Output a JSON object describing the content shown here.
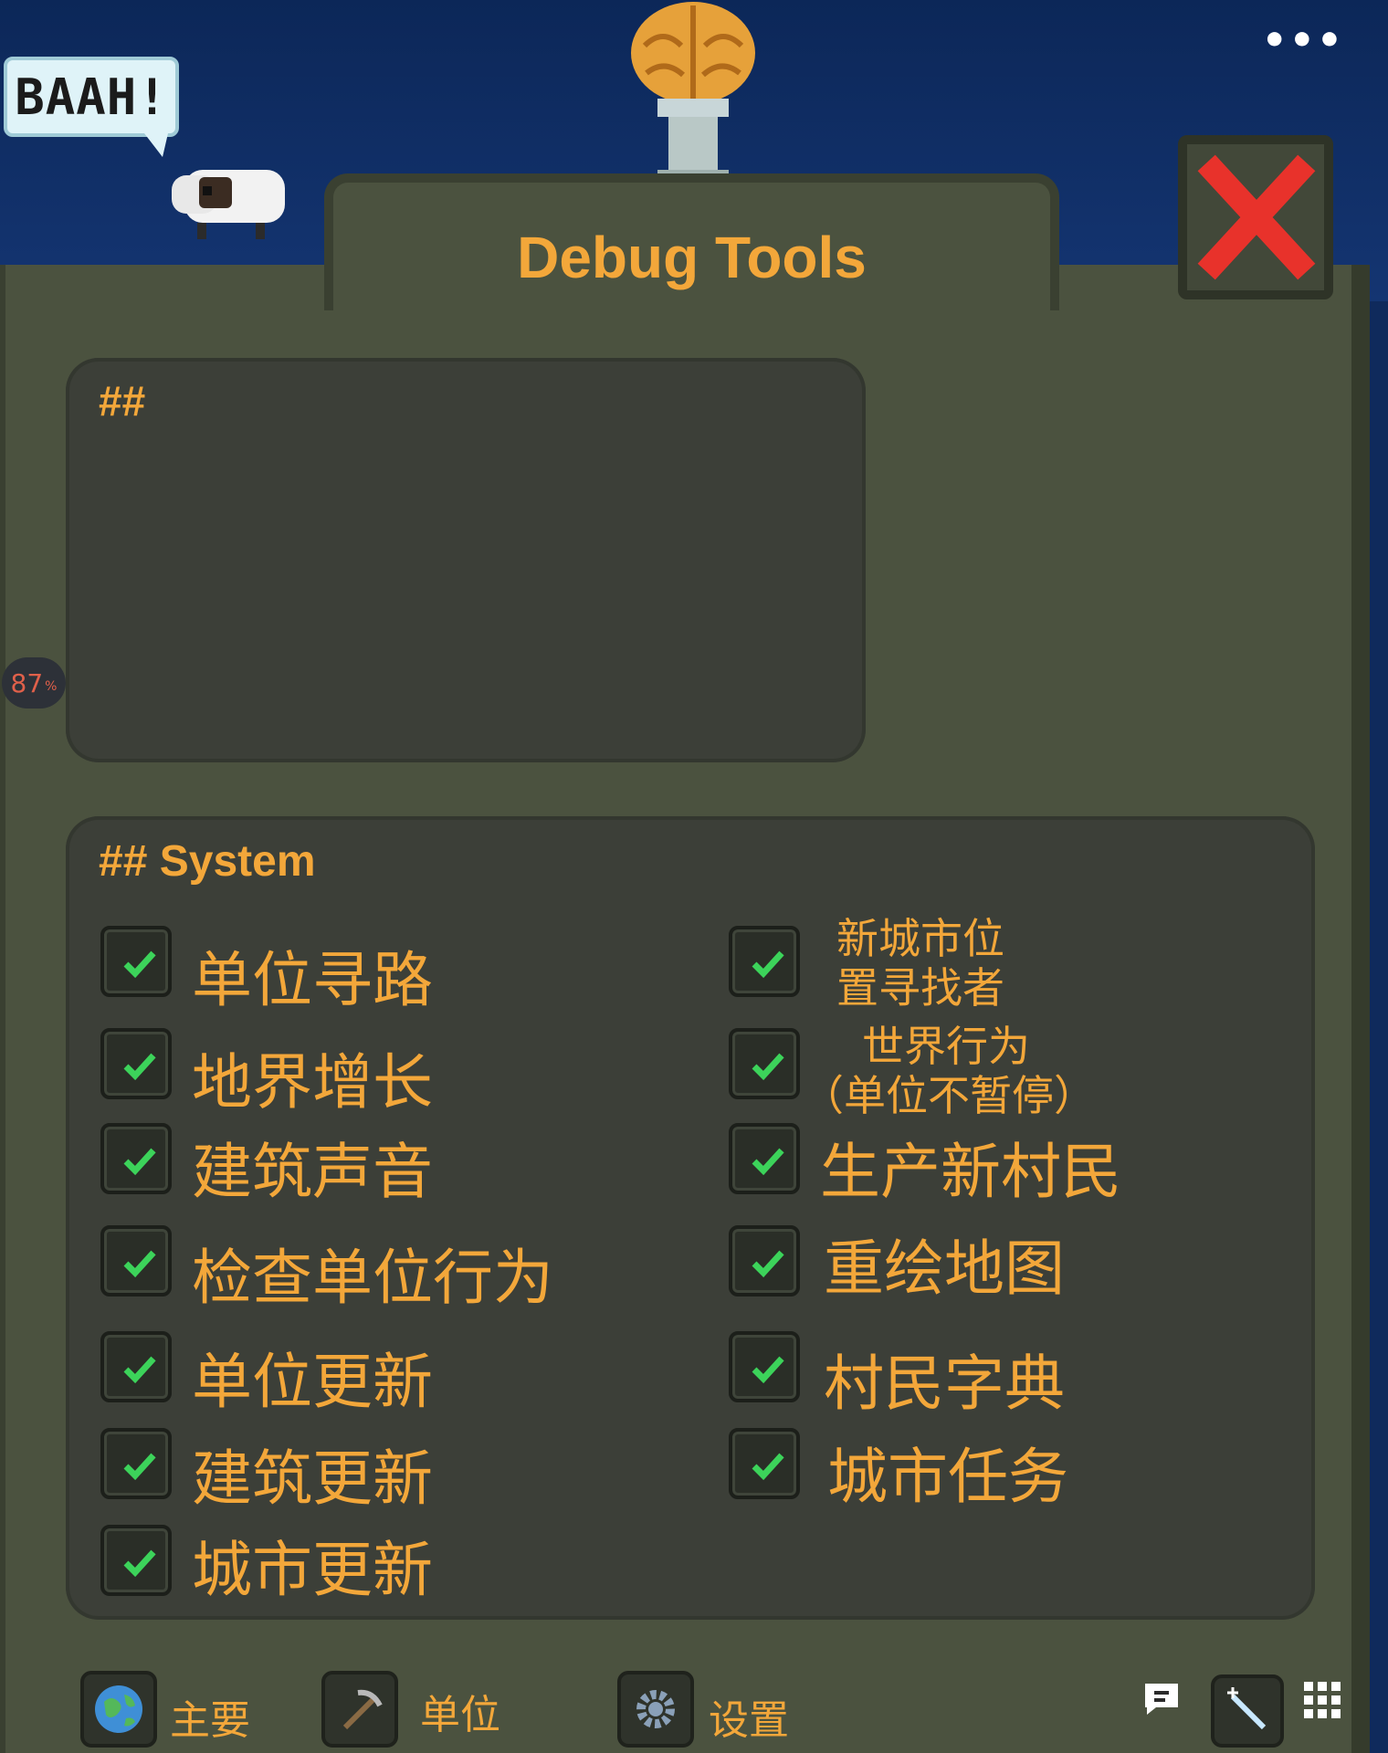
{
  "window": {
    "title": "Debug Tools"
  },
  "speech_bubble": "BAAH!",
  "fps_badge": {
    "value": "87",
    "unit": "%"
  },
  "top_panel": {
    "heading": "##"
  },
  "system_panel": {
    "heading": "## System",
    "left_options": [
      {
        "label": "单位寻路",
        "checked": true
      },
      {
        "label": "地界增长",
        "checked": true
      },
      {
        "label": "建筑声音",
        "checked": true
      },
      {
        "label": "检查单位行为",
        "checked": true
      },
      {
        "label": "单位更新",
        "checked": true
      },
      {
        "label": "建筑更新",
        "checked": true
      },
      {
        "label": "城市更新",
        "checked": true
      }
    ],
    "right_options": [
      {
        "line1": "新城市位",
        "line2": "置寻找者",
        "checked": true
      },
      {
        "line1": "世界行为",
        "line2": "（单位不暂停）",
        "checked": true
      },
      {
        "label": "生产新村民",
        "checked": true
      },
      {
        "label": "重绘地图",
        "checked": true
      },
      {
        "label": "村民字典",
        "checked": true
      },
      {
        "label": "城市任务",
        "checked": true
      }
    ]
  },
  "bottom_tabs": [
    {
      "label": "主要",
      "icon": "globe-icon"
    },
    {
      "label": "单位",
      "icon": "pickaxe-icon"
    },
    {
      "label": "设置",
      "icon": "gear-icon"
    }
  ],
  "system_icons": [
    "chat-bubble-icon",
    "magic-wand-icon",
    "grid-menu-icon"
  ],
  "colors": {
    "accent": "#f3a73a",
    "panel": "#3c3f38",
    "frame": "#4b523f",
    "check": "#3cd35a",
    "close": "#e8322b"
  }
}
